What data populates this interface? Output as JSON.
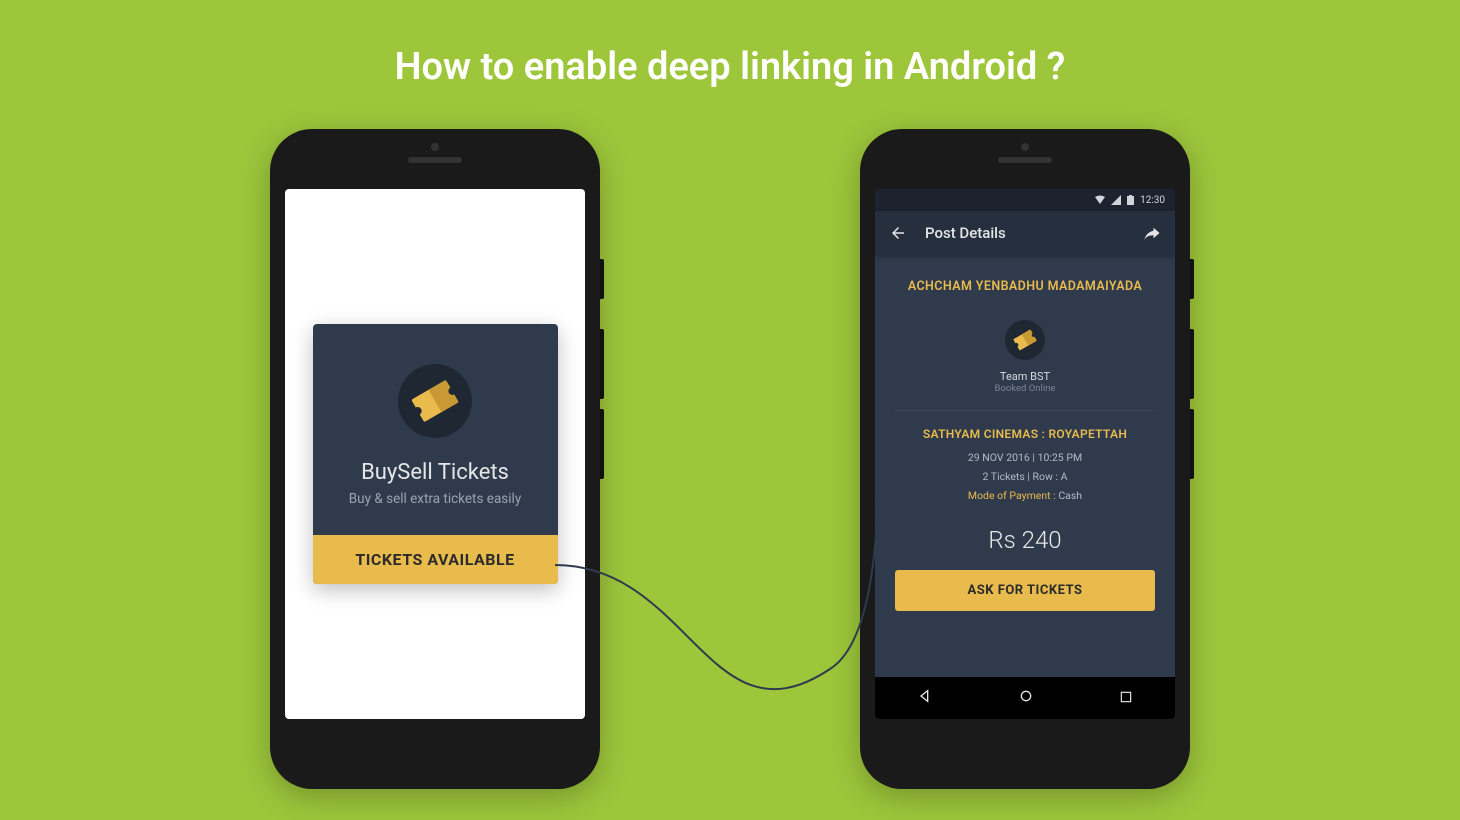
{
  "title": "How to enable deep linking in Android ?",
  "left": {
    "app_name": "BuySell Tickets",
    "tagline": "Buy & sell extra tickets easily",
    "cta": "TICKETS AVAILABLE"
  },
  "right": {
    "status_time": "12:30",
    "topbar_title": "Post Details",
    "movie": "ACHCHAM YENBADHU MADAMAIYADA",
    "team": "Team BST",
    "booked": "Booked Online",
    "venue": "SATHYAM CINEMAS : ROYAPETTAH",
    "datetime": "29 NOV 2016  |  10:25 PM",
    "seats": "2 Tickets  |  Row : A",
    "mop_label": "Mode of Payment : ",
    "mop_value": "Cash",
    "price": "Rs 240",
    "ask_btn": "ASK FOR TICKETS"
  }
}
